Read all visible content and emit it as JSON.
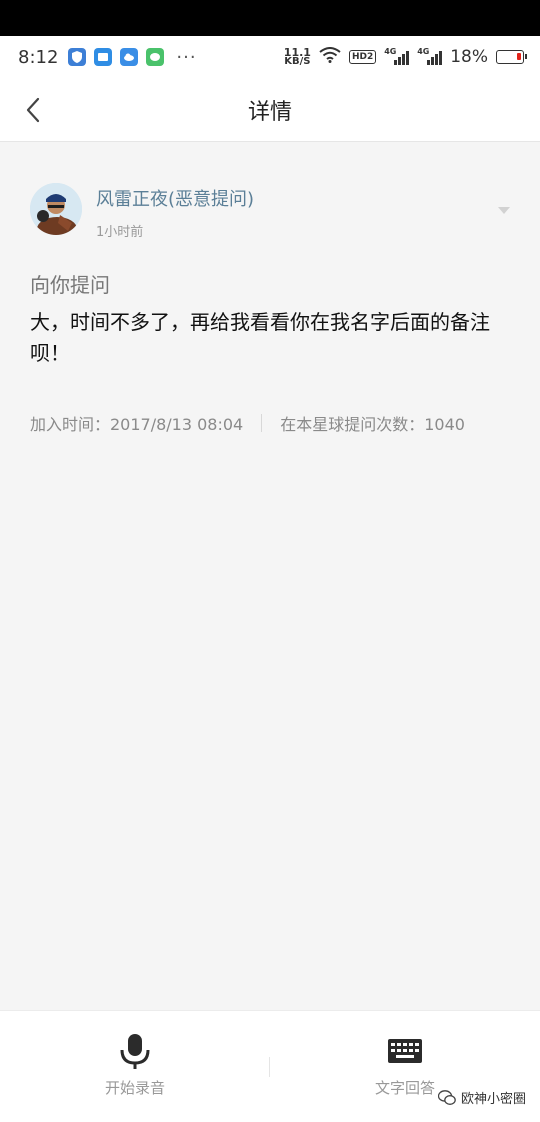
{
  "status_bar": {
    "time": "8:12",
    "net_speed_value": "11.1",
    "net_speed_unit": "KB/S",
    "hd_label": "HD2",
    "signal_label": "4G",
    "battery_percent": "18%",
    "battery_level": 0.18,
    "overflow": "···",
    "app_icons": [
      "shield-app-icon",
      "folder-app-icon",
      "cloud-app-icon",
      "message-app-icon"
    ],
    "battery_color": "#e2231a"
  },
  "nav": {
    "back_icon": "chevron-left-icon",
    "title": "详情"
  },
  "question": {
    "username": "风雷正夜(恶意提问)",
    "time_ago": "1小时前",
    "label": "向你提问",
    "text": "大，时间不多了，再给我看看你在我名字后面的备注呗！",
    "join_time": "加入时间：2017/8/13 08:04",
    "ask_count": "在本星球提问次数：1040"
  },
  "bottom": {
    "record_label": "开始录音",
    "text_label": "文字回答",
    "record_icon": "microphone-icon",
    "text_icon": "keyboard-icon"
  },
  "watermark": {
    "text": "欧神小密圈",
    "icon": "wechat-icon"
  },
  "colors": {
    "username": "#5b7f97",
    "background": "#f5f5f5"
  }
}
